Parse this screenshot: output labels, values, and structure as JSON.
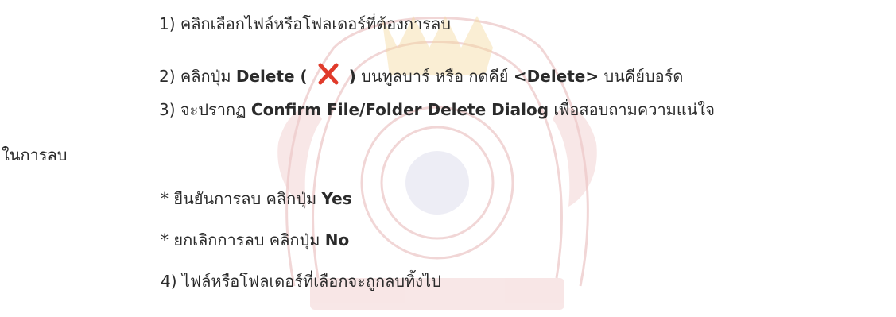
{
  "watermark": {
    "name": "university-seal-watermark",
    "color": "#d88a8a"
  },
  "steps": {
    "step1": "1) คลิกเลือกไฟล์หรือโฟลเดอร์ที่ต้องการลบ",
    "step2_prefix": "2) คลิกปุ่ม ",
    "step2_button": "Delete (",
    "step2_button_close": ")",
    "step2_suffix": " บนทูลบาร์ หรือ กดคีย์ ",
    "step2_key": "<Delete>",
    "step2_end": " บนคีย์บอร์ด",
    "step3_prefix": "3) จะปรากฏ ",
    "step3_dialog": "Confirm File/Folder Delete Dialog",
    "step3_suffix": " เพื่อสอบถามความแน่ใจ",
    "step3_cont": "ในการลบ",
    "confirm_prefix": "* ยืนยันการลบ คลิกปุ่ม ",
    "confirm_button": "Yes",
    "cancel_prefix": "* ยกเลิกการลบ คลิกปุ่ม ",
    "cancel_button": "No",
    "step4": "4) ไฟล์หรือโฟลเดอร์ที่เลือกจะถูกลบทิ้งไป"
  },
  "icons": {
    "delete_icon": "close-x-icon",
    "delete_icon_color": "#e03a2a"
  }
}
